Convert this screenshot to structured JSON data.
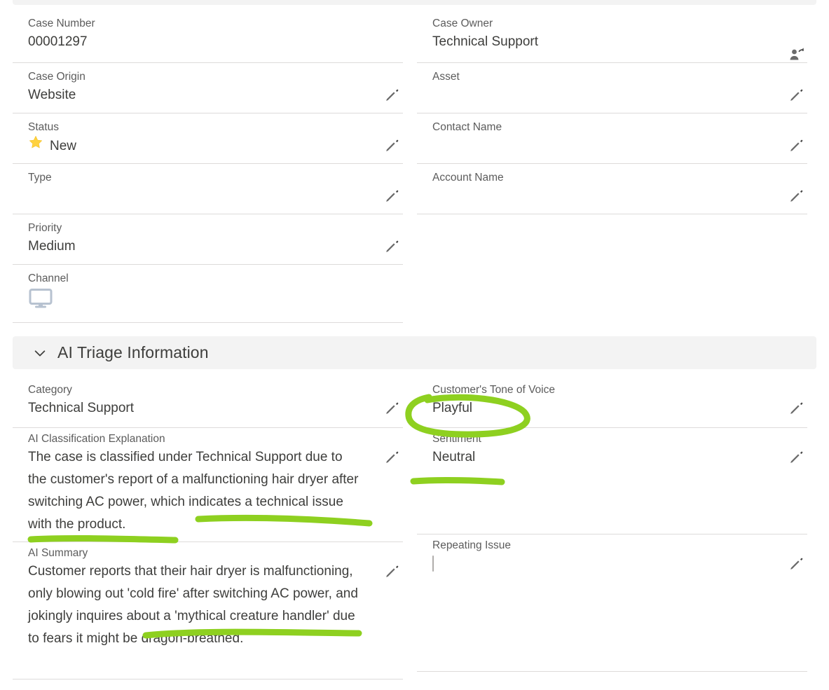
{
  "record": {
    "left_fields": [
      {
        "label": "Case Number",
        "value": "00001297",
        "action_icon": null
      },
      {
        "label": "Case Origin",
        "value": "Website",
        "action_icon": "pencil-icon"
      },
      {
        "label": "Status",
        "value": "New",
        "value_icon": "star-icon",
        "action_icon": "pencil-icon"
      },
      {
        "label": "Type",
        "value": "",
        "action_icon": "pencil-icon"
      },
      {
        "label": "Priority",
        "value": "Medium",
        "action_icon": "pencil-icon"
      },
      {
        "label": "Channel",
        "value": "",
        "value_icon": "desktop-monitor-icon",
        "action_icon": null
      }
    ],
    "right_fields": [
      {
        "label": "Case Owner",
        "value": "Technical Support",
        "action_icon": "change-owner-icon"
      },
      {
        "label": "Asset",
        "value": "",
        "action_icon": "pencil-icon"
      },
      {
        "label": "Contact Name",
        "value": "",
        "action_icon": "pencil-icon"
      },
      {
        "label": "Account Name",
        "value": "",
        "action_icon": "pencil-icon"
      }
    ]
  },
  "ai_section": {
    "title": "AI Triage Information",
    "collapse_icon": "chevron-down-icon",
    "left_fields": [
      {
        "label": "Category",
        "value": "Technical Support",
        "action_icon": "pencil-icon"
      },
      {
        "label": "AI Classification Explanation",
        "value": "The case is classified under Technical Support due to the customer's report of a malfunctioning hair dryer after switching AC power, which indicates a technical issue with the product.",
        "action_icon": "pencil-icon"
      },
      {
        "label": "AI Summary",
        "value": "Customer reports that their hair dryer is malfunctioning, only blowing out 'cold fire' after switching AC power, and jokingly inquires about a 'mythical creature handler' due to fears it might be dragon-breathed.",
        "action_icon": "pencil-icon"
      }
    ],
    "right_fields": [
      {
        "label": "Customer's Tone of Voice",
        "value": "Playful",
        "action_icon": "pencil-icon"
      },
      {
        "label": "Sentiment",
        "value": "Neutral",
        "action_icon": "pencil-icon"
      },
      {
        "label": "Repeating Issue",
        "value": "",
        "value_icon": "checkbox-unchecked-icon",
        "action_icon": "pencil-icon"
      }
    ]
  },
  "annotations": {
    "color": "#8ed020",
    "marks": [
      {
        "type": "ellipse",
        "target": "Playful"
      },
      {
        "type": "underline",
        "target": "Neutral"
      },
      {
        "type": "underline",
        "target": "which indicates a technical"
      },
      {
        "type": "underline",
        "target": "issue with the product."
      },
      {
        "type": "underline",
        "target": "and jokingly inquires about a"
      }
    ]
  },
  "colors": {
    "star": "#FFD23F",
    "divider": "#dddbda",
    "section_bg": "#f3f3f3",
    "label_text": "#5c5c5c",
    "value_text": "#3e3e3c",
    "monitor": "#b7c2d0"
  }
}
